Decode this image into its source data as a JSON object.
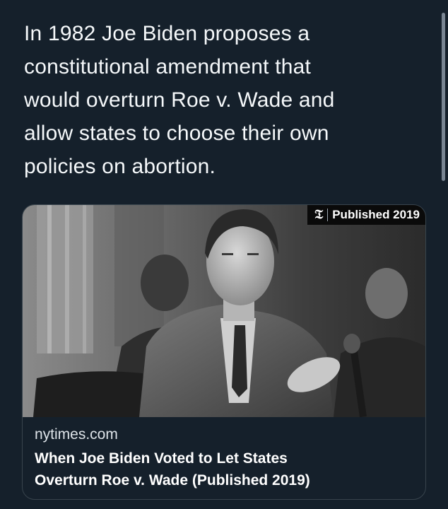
{
  "tweet": {
    "text": "In 1982 Joe Biden proposes a\nconstitutional amendment that\nwould overturn Roe v. Wade and\nallow states to choose their own\npolicies on abortion."
  },
  "link_card": {
    "badge_icon": "nyt-logo-icon",
    "badge_text": "Published 2019",
    "domain": "nytimes.com",
    "title": "When Joe Biden Voted to Let States\nOverturn Roe v. Wade (Published 2019)"
  },
  "colors": {
    "background": "#15202b",
    "card_border": "#38444d",
    "text_primary": "#ffffff",
    "text_secondary": "#dde3e8"
  }
}
